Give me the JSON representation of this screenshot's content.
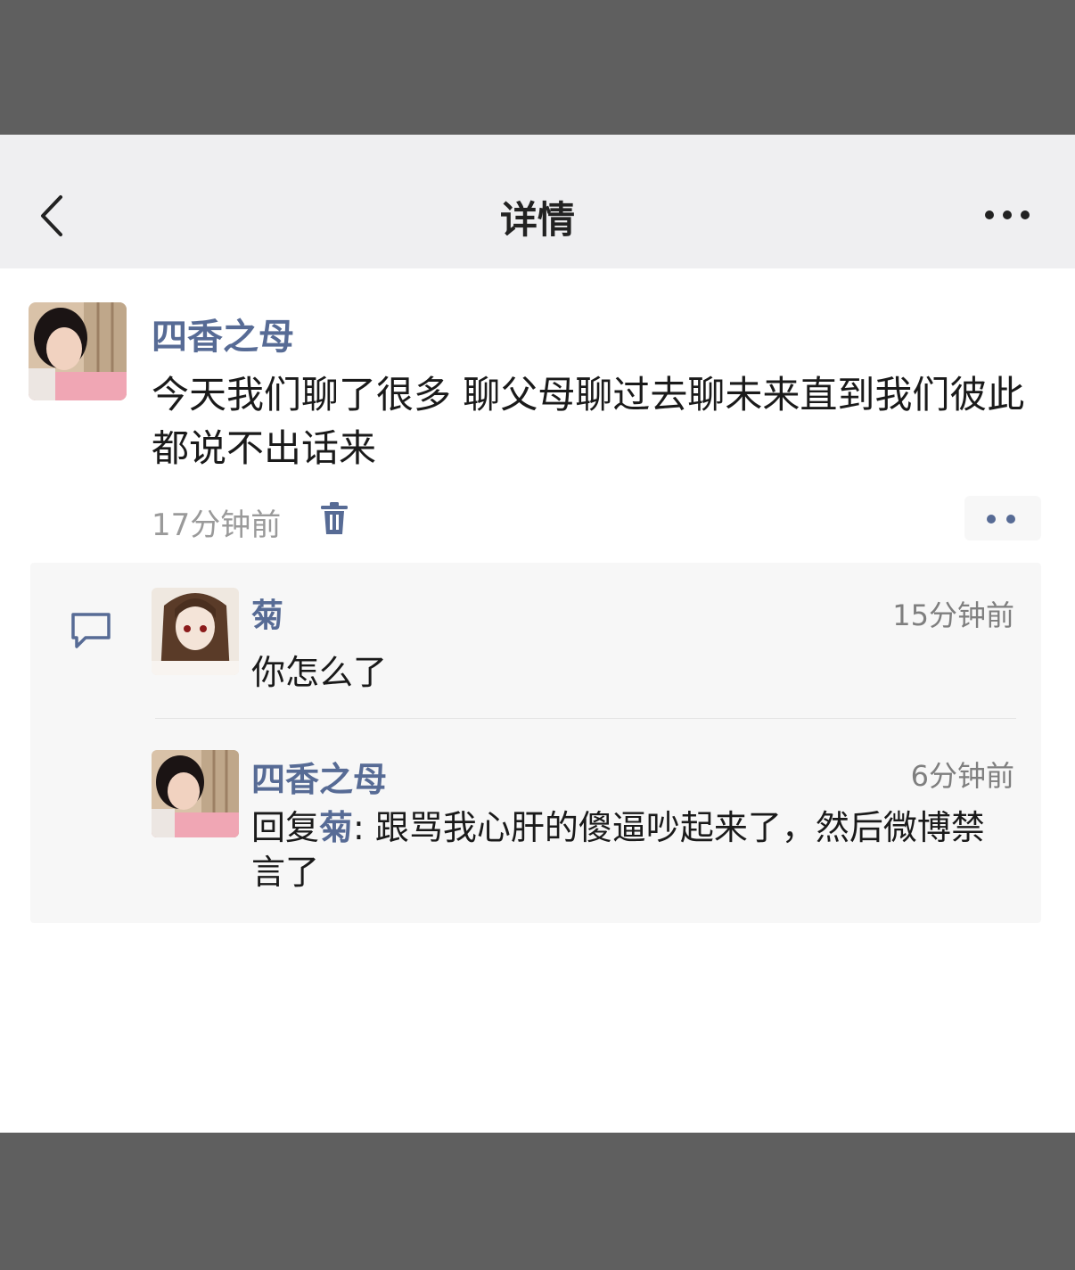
{
  "nav": {
    "title": "详情"
  },
  "post": {
    "author": "四香之母",
    "text": "今天我们聊了很多 聊父母聊过去聊未来直到我们彼此都说不出话来",
    "time": "17分钟前"
  },
  "comments": [
    {
      "author": "菊",
      "time": "15分钟前",
      "text": "你怎么了"
    },
    {
      "author": "四香之母",
      "time": "6分钟前",
      "reply_prefix": "回复",
      "reply_to": "菊",
      "text": ": 跟骂我心肝的傻逼吵起来了，然后微博禁言了"
    }
  ],
  "colors": {
    "link": "#576b95",
    "navbar": "#efeff1",
    "panel": "#f7f7f7",
    "backdrop": "#5f5f5f"
  },
  "icons": [
    "back-icon",
    "more-icon",
    "delete-icon",
    "comment-icon"
  ]
}
